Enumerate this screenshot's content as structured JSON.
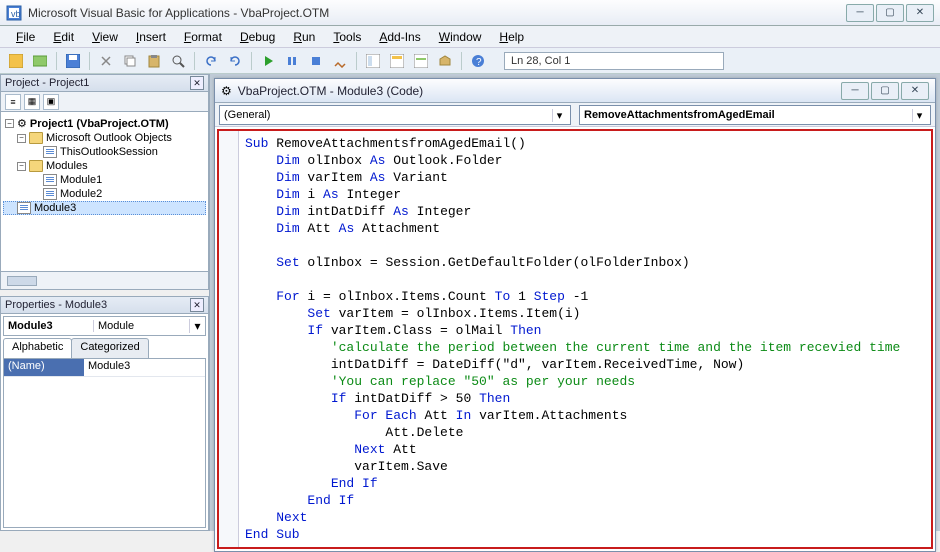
{
  "window": {
    "title": "Microsoft Visual Basic for Applications - VbaProject.OTM"
  },
  "menus": [
    "File",
    "Edit",
    "View",
    "Insert",
    "Format",
    "Debug",
    "Run",
    "Tools",
    "Add-Ins",
    "Window",
    "Help"
  ],
  "toolbar": {
    "position": "Ln 28, Col 1"
  },
  "project_panel": {
    "title": "Project - Project1",
    "root": "Project1 (VbaProject.OTM)",
    "group1": "Microsoft Outlook Objects",
    "obj1": "ThisOutlookSession",
    "group2": "Modules",
    "mods": [
      "Module1",
      "Module2",
      "Module3"
    ],
    "selected": "Module3"
  },
  "props_panel": {
    "title": "Properties - Module3",
    "object": "Module3",
    "type": "Module",
    "tabs": [
      "Alphabetic",
      "Categorized"
    ],
    "rows": [
      {
        "k": "(Name)",
        "v": "Module3"
      }
    ]
  },
  "child_window": {
    "title": "VbaProject.OTM - Module3 (Code)",
    "combo_left": "(General)",
    "combo_right": "RemoveAttachmentsfromAgedEmail"
  },
  "code_tokens": [
    [
      [
        "kw",
        "Sub"
      ],
      [
        "",
        " RemoveAttachmentsfromAgedEmail()"
      ]
    ],
    [
      [
        "",
        "    "
      ],
      [
        "kw",
        "Dim"
      ],
      [
        "",
        " olInbox "
      ],
      [
        "kw",
        "As"
      ],
      [
        "",
        " Outlook.Folder"
      ]
    ],
    [
      [
        "",
        "    "
      ],
      [
        "kw",
        "Dim"
      ],
      [
        "",
        " varItem "
      ],
      [
        "kw",
        "As"
      ],
      [
        "",
        " Variant"
      ]
    ],
    [
      [
        "",
        "    "
      ],
      [
        "kw",
        "Dim"
      ],
      [
        "",
        " i "
      ],
      [
        "kw",
        "As"
      ],
      [
        "",
        " Integer"
      ]
    ],
    [
      [
        "",
        "    "
      ],
      [
        "kw",
        "Dim"
      ],
      [
        "",
        " intDatDiff "
      ],
      [
        "kw",
        "As"
      ],
      [
        "",
        " Integer"
      ]
    ],
    [
      [
        "",
        "    "
      ],
      [
        "kw",
        "Dim"
      ],
      [
        "",
        " Att "
      ],
      [
        "kw",
        "As"
      ],
      [
        "",
        " Attachment"
      ]
    ],
    [
      [
        "",
        ""
      ]
    ],
    [
      [
        "",
        "    "
      ],
      [
        "kw",
        "Set"
      ],
      [
        "",
        " olInbox = Session.GetDefaultFolder(olFolderInbox)"
      ]
    ],
    [
      [
        "",
        ""
      ]
    ],
    [
      [
        "",
        "    "
      ],
      [
        "kw",
        "For"
      ],
      [
        "",
        " i = olInbox.Items.Count "
      ],
      [
        "kw",
        "To"
      ],
      [
        "",
        " 1 "
      ],
      [
        "kw",
        "Step"
      ],
      [
        "",
        " -1"
      ]
    ],
    [
      [
        "",
        "        "
      ],
      [
        "kw",
        "Set"
      ],
      [
        "",
        " varItem = olInbox.Items.Item(i)"
      ]
    ],
    [
      [
        "",
        "        "
      ],
      [
        "kw",
        "If"
      ],
      [
        "",
        " varItem.Class = olMail "
      ],
      [
        "kw",
        "Then"
      ]
    ],
    [
      [
        "",
        "           "
      ],
      [
        "cm",
        "'calculate the period between the current time and the item recevied time"
      ]
    ],
    [
      [
        "",
        "           intDatDiff = DateDiff(\"d\", varItem.ReceivedTime, Now)"
      ]
    ],
    [
      [
        "",
        "           "
      ],
      [
        "cm",
        "'You can replace \"50\" as per your needs"
      ]
    ],
    [
      [
        "",
        "           "
      ],
      [
        "kw",
        "If"
      ],
      [
        "",
        " intDatDiff > 50 "
      ],
      [
        "kw",
        "Then"
      ]
    ],
    [
      [
        "",
        "              "
      ],
      [
        "kw",
        "For Each"
      ],
      [
        "",
        " Att "
      ],
      [
        "kw",
        "In"
      ],
      [
        "",
        " varItem.Attachments"
      ]
    ],
    [
      [
        "",
        "                  Att.Delete"
      ]
    ],
    [
      [
        "",
        "              "
      ],
      [
        "kw",
        "Next"
      ],
      [
        "",
        " Att"
      ]
    ],
    [
      [
        "",
        "              varItem.Save"
      ]
    ],
    [
      [
        "",
        "           "
      ],
      [
        "kw",
        "End If"
      ]
    ],
    [
      [
        "",
        "        "
      ],
      [
        "kw",
        "End If"
      ]
    ],
    [
      [
        "",
        "    "
      ],
      [
        "kw",
        "Next"
      ]
    ],
    [
      [
        "kw",
        "End Sub"
      ]
    ]
  ]
}
